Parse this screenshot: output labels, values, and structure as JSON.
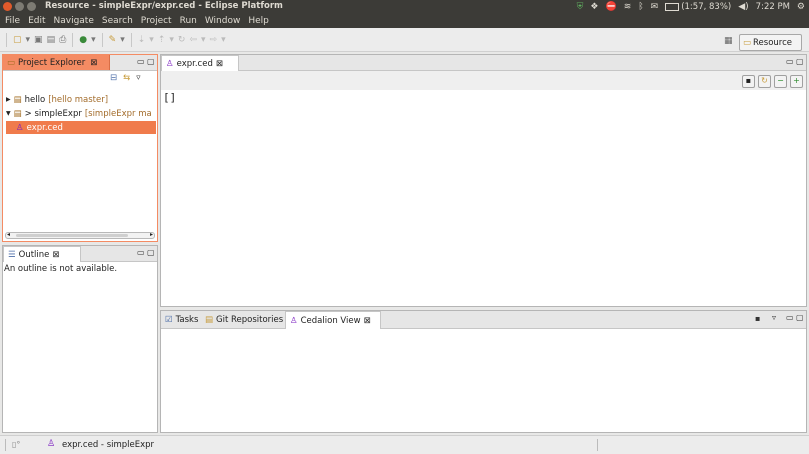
{
  "window": {
    "title": "Resource - simpleExpr/expr.ced - Eclipse Platform",
    "tray_battery": "(1:57, 83%)",
    "tray_clock": "7:22 PM",
    "close_color": "#e05a2b"
  },
  "menu": [
    "File",
    "Edit",
    "Navigate",
    "Search",
    "Project",
    "Run",
    "Window",
    "Help"
  ],
  "toolbar": {
    "perspective_label": "Resource"
  },
  "project_explorer": {
    "tab_label": "Project Explorer",
    "close_glyph": "⊠",
    "items": [
      {
        "name": "hello",
        "decoration": "[hello master]"
      },
      {
        "name": "> simpleExpr",
        "decoration": "[simpleExpr ma"
      },
      {
        "name": "expr.ced",
        "decoration": ""
      }
    ]
  },
  "outline": {
    "tab_label": "Outline",
    "message": "An outline is not available."
  },
  "editor": {
    "tab_label": "expr.ced",
    "content": "[]"
  },
  "bottom_panel": {
    "tabs": [
      "Tasks",
      "Git Repositories",
      "Cedalion View"
    ]
  },
  "status": {
    "text": "expr.ced - simpleExpr"
  },
  "colors": {
    "accent": "#f07b4c",
    "titlebar": "#3c3b37"
  }
}
